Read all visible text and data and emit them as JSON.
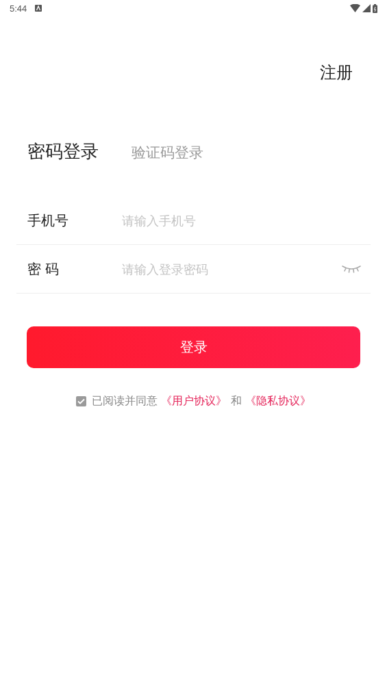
{
  "status_bar": {
    "time": "5:44"
  },
  "register_link": "注册",
  "tabs": [
    {
      "label": "密码登录",
      "selected": true
    },
    {
      "label": "验证码登录",
      "selected": false
    }
  ],
  "fields": [
    {
      "label": "手机号",
      "placeholder": "请输入手机号",
      "kind": "text"
    },
    {
      "label": "密 码",
      "placeholder": "请输入登录密码",
      "kind": "password"
    }
  ],
  "login_button": "登录",
  "agreement": {
    "checked": true,
    "prefix": "已阅读并同意",
    "user_agreement": "《用户协议》",
    "conjunction": "和",
    "privacy_agreement": "《隐私协议》"
  }
}
